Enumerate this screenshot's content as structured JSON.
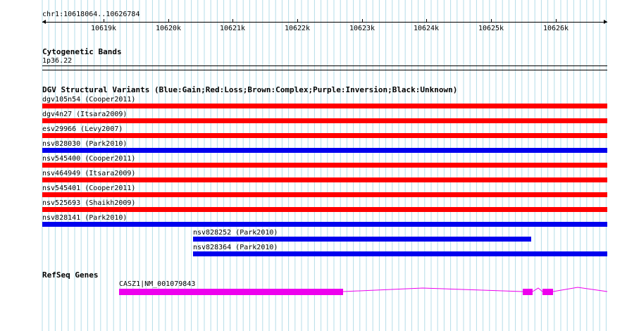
{
  "ruler": {
    "coordinates": "chr1:10618064..10626784",
    "ticks": [
      "10619k",
      "10620k",
      "10621k",
      "10622k",
      "10623k",
      "10624k",
      "10625k",
      "10626k"
    ]
  },
  "cytoband": {
    "title": "Cytogenetic Bands",
    "band": "1p36.22"
  },
  "dgv": {
    "title": "DGV Structural Variants (Blue:Gain;Red:Loss;Brown:Complex;Purple:Inversion;Black:Unknown)",
    "colors": {
      "gain": "#0000ee",
      "loss": "#ff0000"
    },
    "variants": [
      {
        "label": "dgv105n54 (Cooper2011)",
        "type": "loss"
      },
      {
        "label": "dgv4n27 (Itsara2009)",
        "type": "loss"
      },
      {
        "label": "esv29966 (Levy2007)",
        "type": "loss"
      },
      {
        "label": "nsv828030 (Park2010)",
        "type": "gain"
      },
      {
        "label": "nsv545400 (Cooper2011)",
        "type": "loss"
      },
      {
        "label": "nsv464949 (Itsara2009)",
        "type": "loss"
      },
      {
        "label": "nsv545401 (Cooper2011)",
        "type": "loss"
      },
      {
        "label": "nsv525693 (Shaikh2009)",
        "type": "loss"
      },
      {
        "label": "nsv828141 (Park2010)",
        "type": "gain"
      },
      {
        "label": "nsv828252 (Park2010)",
        "type": "gain"
      },
      {
        "label": "nsv828364 (Park2010)",
        "type": "gain"
      }
    ]
  },
  "refseq": {
    "title": "RefSeq Genes",
    "gene_label": "CASZ1|NM_001079843",
    "color": "#ee00ee"
  }
}
